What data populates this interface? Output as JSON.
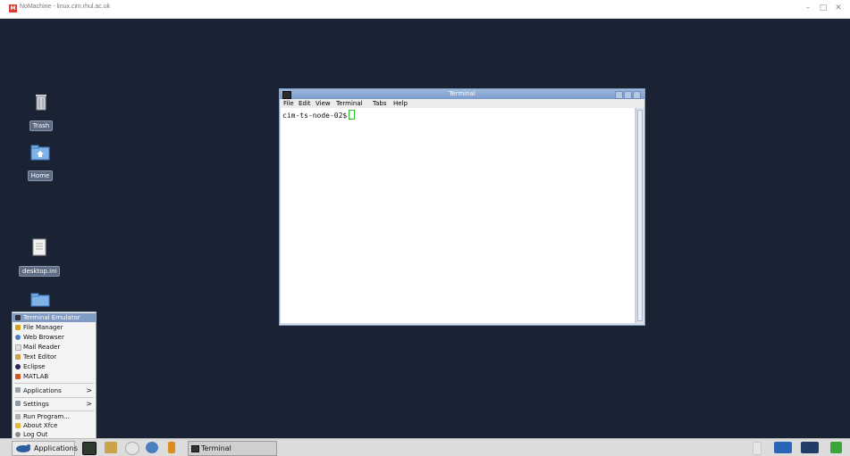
{
  "host": {
    "title": "NoMachine - linux.cim.rhul.ac.uk",
    "logo_text": "M",
    "minimize": "–",
    "maximize": "□",
    "close": "✕"
  },
  "desktop": {
    "icons": [
      {
        "label": "Trash"
      },
      {
        "label": "Home"
      },
      {
        "label": "desktop.ini"
      }
    ]
  },
  "terminal": {
    "title": "Terminal",
    "menu": [
      "File",
      "Edit",
      "View",
      "Terminal",
      "Tabs",
      "Help"
    ],
    "prompt": "cim-ts-node-02$"
  },
  "app_menu": {
    "items": [
      {
        "label": "Terminal Emulator",
        "icon": "terminal-icon",
        "selected": true
      },
      {
        "label": "File Manager",
        "icon": "folder-icon"
      },
      {
        "label": "Web Browser",
        "icon": "globe-icon"
      },
      {
        "label": "Mail Reader",
        "icon": "mail-icon"
      },
      {
        "label": "Text Editor",
        "icon": "pencil-icon"
      },
      {
        "label": "Eclipse",
        "icon": "eclipse-icon"
      },
      {
        "label": "MATLAB",
        "icon": "matlab-icon"
      },
      {
        "label": "Applications",
        "icon": "apps-icon",
        "submenu": true
      },
      {
        "label": "Settings",
        "icon": "settings-icon",
        "submenu": true
      },
      {
        "label": "Run Program...",
        "icon": "run-icon"
      },
      {
        "label": "About Xfce",
        "icon": "star-icon"
      },
      {
        "label": "Log Out",
        "icon": "logout-icon"
      }
    ],
    "arrow": ">"
  },
  "panel": {
    "applications_label": "Applications",
    "task_label": "Terminal"
  },
  "colors": {
    "desktop": "#1a2333",
    "selection": "#7f9bc6",
    "titlebar": "#8aa8d4"
  }
}
